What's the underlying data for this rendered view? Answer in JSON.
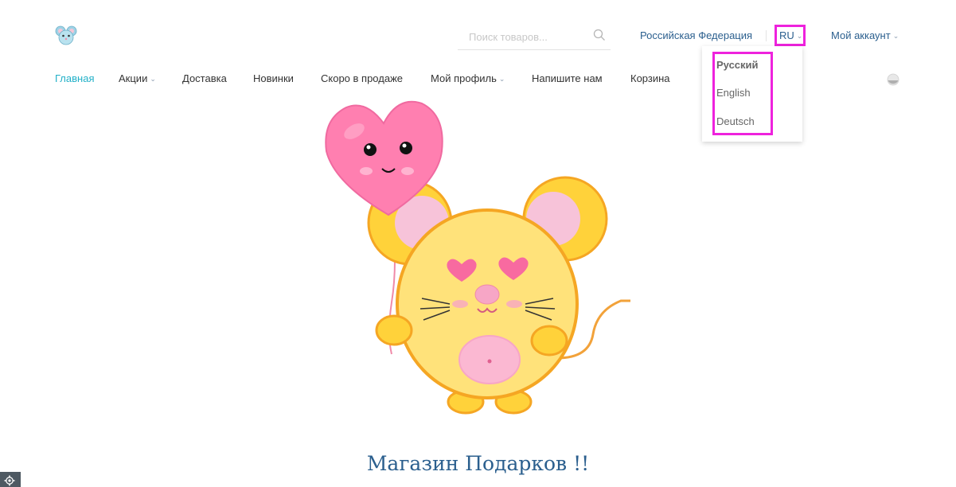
{
  "header": {
    "logo_alt": "mouse-logo",
    "search": {
      "placeholder": "Поиск товаров...",
      "value": ""
    },
    "region": "Российская Федерация",
    "language": {
      "current": "RU",
      "options": [
        {
          "label": "Русский",
          "selected": true
        },
        {
          "label": "English",
          "selected": false
        },
        {
          "label": "Deutsch",
          "selected": false
        }
      ]
    },
    "account": "Мой аккаунт"
  },
  "nav": {
    "items": [
      {
        "label": "Главная",
        "active": true,
        "dropdown": false
      },
      {
        "label": "Акции",
        "active": false,
        "dropdown": true
      },
      {
        "label": "Доставка",
        "active": false,
        "dropdown": false
      },
      {
        "label": "Новинки",
        "active": false,
        "dropdown": false
      },
      {
        "label": "Скоро в продаже",
        "active": false,
        "dropdown": false
      },
      {
        "label": "Мой профиль",
        "active": false,
        "dropdown": true
      },
      {
        "label": "Напишите нам",
        "active": false,
        "dropdown": false
      },
      {
        "label": "Корзина",
        "active": false,
        "dropdown": false
      }
    ]
  },
  "main": {
    "title": "Магазин Подарков !!"
  },
  "colors": {
    "accent": "#22b0c8",
    "link": "#2b5f8e",
    "highlight": "#ee22dd"
  },
  "icons": {
    "search": "search-icon",
    "chevron": "chevron-down-icon",
    "theme": "theme-toggle-icon",
    "settings": "gear-icon"
  }
}
